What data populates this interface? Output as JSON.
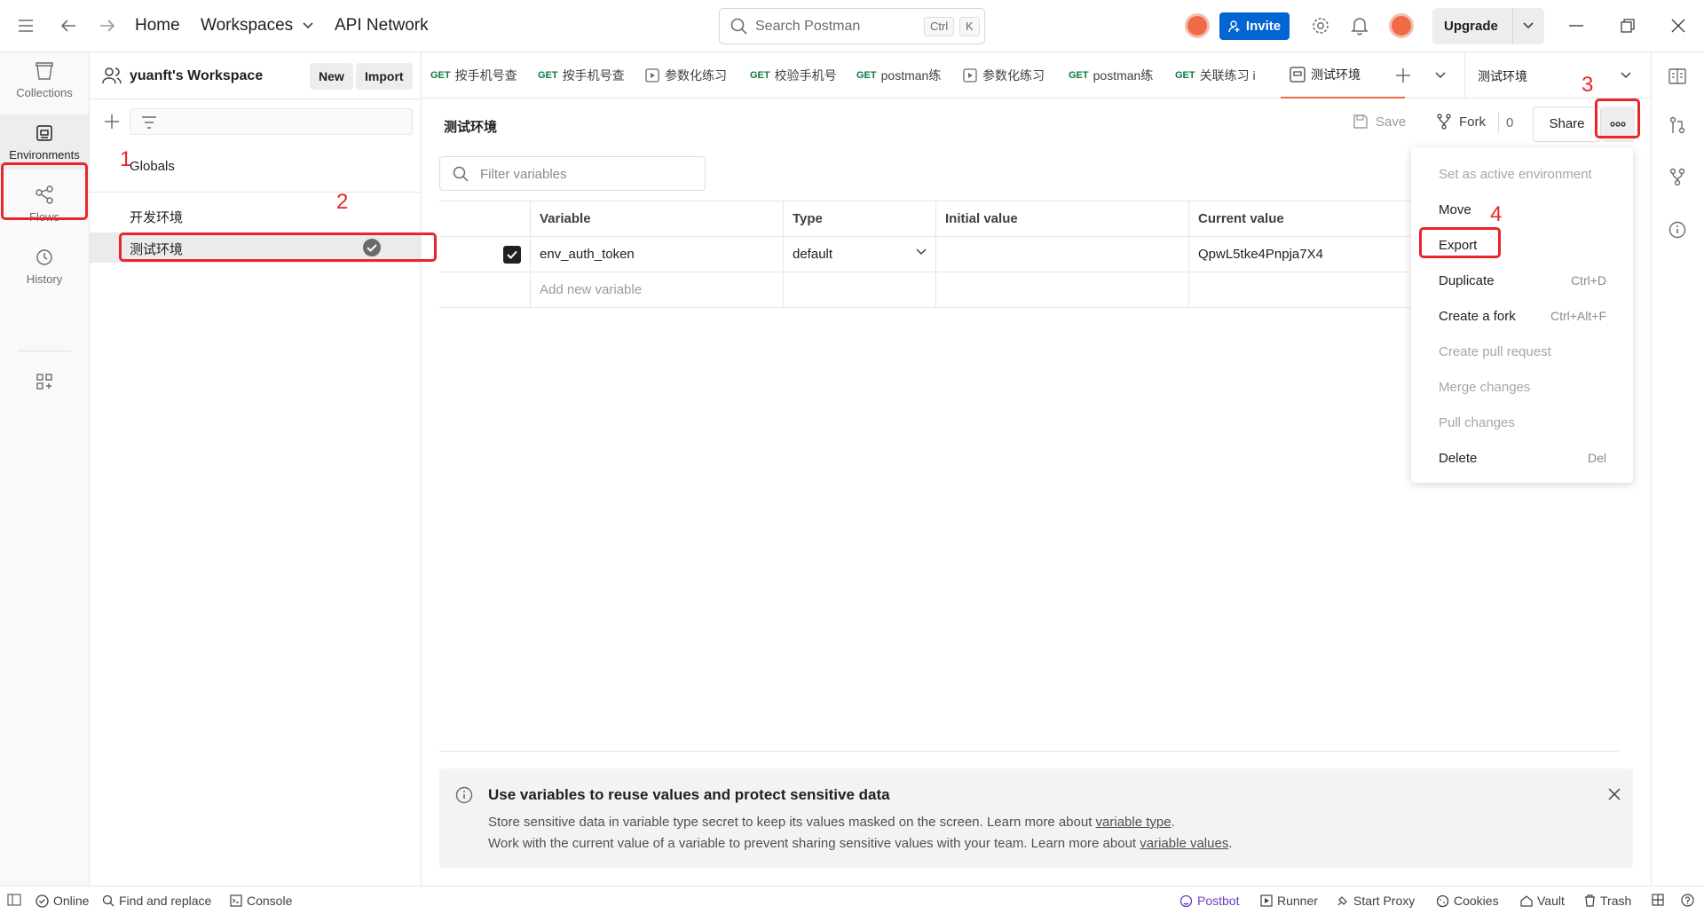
{
  "topbar": {
    "home": "Home",
    "workspaces": "Workspaces",
    "api_network": "API Network",
    "search_placeholder": "Search Postman",
    "search_kbd_ctrl": "Ctrl",
    "search_kbd_k": "K",
    "invite": "Invite",
    "upgrade": "Upgrade"
  },
  "sidebar": {
    "workspace_name": "yuanft's Workspace",
    "new_label": "New",
    "import_label": "Import",
    "globals": "Globals",
    "environments": [
      "开发环境",
      "测试环境"
    ]
  },
  "left_rail": {
    "collections": "Collections",
    "environments": "Environments",
    "flows": "Flows",
    "history": "History"
  },
  "tabs": [
    {
      "method": "GET",
      "label": "按手机号查"
    },
    {
      "method": "GET",
      "label": "按手机号查"
    },
    {
      "method": "",
      "label": "参数化练习"
    },
    {
      "method": "GET",
      "label": "校验手机号"
    },
    {
      "method": "GET",
      "label": "postman练"
    },
    {
      "method": "",
      "label": "参数化练习"
    },
    {
      "method": "GET",
      "label": "postman练"
    },
    {
      "method": "GET",
      "label": "关联练习 i"
    },
    {
      "method": "",
      "label": "测试环境"
    }
  ],
  "env_selector": "测试环境",
  "main": {
    "title": "测试环境",
    "save": "Save",
    "fork": "Fork",
    "fork_count": "0",
    "share": "Share",
    "filter_placeholder": "Filter variables",
    "columns": [
      "Variable",
      "Type",
      "Initial value",
      "Current value"
    ],
    "rows": [
      {
        "variable": "env_auth_token",
        "type": "default",
        "initial": "",
        "current": "QpwL5tke4Pnpja7X4"
      }
    ],
    "add_placeholder": "Add new variable"
  },
  "menu": [
    {
      "label": "Set as active environment",
      "shortcut": "",
      "disabled": true
    },
    {
      "label": "Move",
      "shortcut": "",
      "disabled": false
    },
    {
      "label": "Export",
      "shortcut": "",
      "disabled": false
    },
    {
      "label": "Duplicate",
      "shortcut": "Ctrl+D",
      "disabled": false
    },
    {
      "label": "Create a fork",
      "shortcut": "Ctrl+Alt+F",
      "disabled": false
    },
    {
      "label": "Create pull request",
      "shortcut": "",
      "disabled": true
    },
    {
      "label": "Merge changes",
      "shortcut": "",
      "disabled": true
    },
    {
      "label": "Pull changes",
      "shortcut": "",
      "disabled": true
    },
    {
      "label": "Delete",
      "shortcut": "Del",
      "disabled": false
    }
  ],
  "banner": {
    "title": "Use variables to reuse values and protect sensitive data",
    "line1_prefix": "Store sensitive data in variable type secret to keep its values masked on the screen. Learn more about ",
    "line1_link": "variable type",
    "line1_suffix": ".",
    "line2_prefix": "Work with the current value of a variable to prevent sharing sensitive values with your team. Learn more about ",
    "line2_link": "variable values",
    "line2_suffix": "."
  },
  "statusbar": {
    "online": "Online",
    "find_replace": "Find and replace",
    "console": "Console",
    "postbot": "Postbot",
    "runner": "Runner",
    "start_proxy": "Start Proxy",
    "cookies": "Cookies",
    "vault": "Vault",
    "trash": "Trash"
  },
  "annotations": [
    "1",
    "2",
    "3",
    "4"
  ],
  "colors": {
    "accent_blue": "#0265d2",
    "annotation_red": "#e8262a",
    "postbot_purple": "#6f3dbf",
    "get_green": "#0b7b3e"
  }
}
